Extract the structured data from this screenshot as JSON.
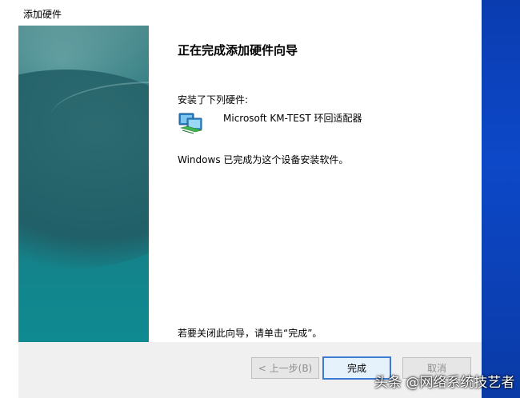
{
  "window": {
    "title": "添加硬件"
  },
  "content": {
    "heading": "正在完成添加硬件向导",
    "installed_label": "安装了下列硬件:",
    "device_name": "Microsoft KM-TEST 环回适配器",
    "device_icon": "network-adapter-icon",
    "done_text": "Windows 已完成为这个设备安装软件。",
    "close_hint": "若要关闭此向导，请单击“完成”。"
  },
  "buttons": {
    "back_label": "< 上一步(B)",
    "finish_label": "完成",
    "cancel_label": "取消"
  },
  "watermark": {
    "text": "头条 @网络系统技艺者"
  },
  "colors": {
    "desktop_blue": "#0d48c8",
    "focus_border": "#3d7bd2",
    "panel_teal": "#1b7a84"
  }
}
